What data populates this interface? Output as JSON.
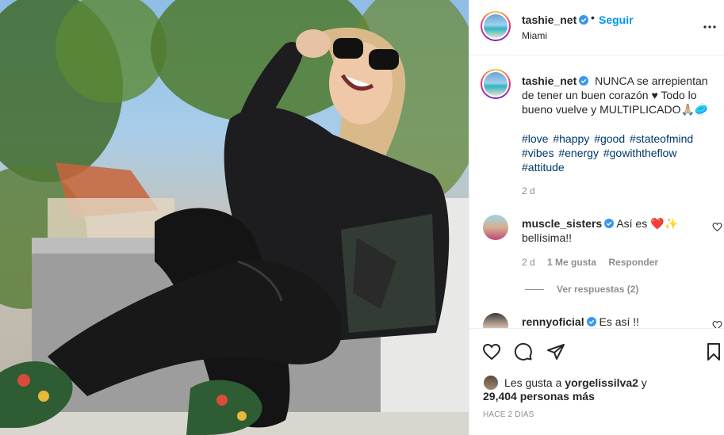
{
  "post": {
    "username": "tashie_net",
    "dot": "•",
    "follow_label": "Seguir",
    "location": "Miami",
    "more_icon": "more-horizontal-icon"
  },
  "caption": {
    "username": "tashie_net",
    "text": "NUNCA se arrepientan de tener un buen corazón ♥ Todo lo bueno vuelve y MULTIPLICADO🙏🏼🥏",
    "hashtags": [
      "#love",
      "#happy",
      "#good",
      "#stateofmind",
      "#vibes",
      "#energy",
      "#gowiththeflow",
      "#attitude"
    ],
    "time": "2 d"
  },
  "comments": [
    {
      "username": "muscle_sisters",
      "text": "Así es ❤️✨ bellísima!!",
      "time": "2 d",
      "likes": "1 Me gusta",
      "reply_label": "Responder",
      "view_replies": "Ver respuestas (2)"
    },
    {
      "username": "rennyoficial",
      "text": "Es así !!"
    }
  ],
  "actions": {
    "icons": [
      "heart-icon",
      "comment-icon",
      "share-icon",
      "bookmark-icon"
    ],
    "likes_prefix": "Les gusta a",
    "liked_by": "yorgelissilva2",
    "likes_conj": "y",
    "likes_count": "29,404 personas más",
    "time_ago": "HACE 2 DÍAS"
  },
  "colors": {
    "link_blue": "#0095f6",
    "hashtag": "#00376b",
    "muted": "#8e8e8e",
    "verified": "#3897f0"
  }
}
